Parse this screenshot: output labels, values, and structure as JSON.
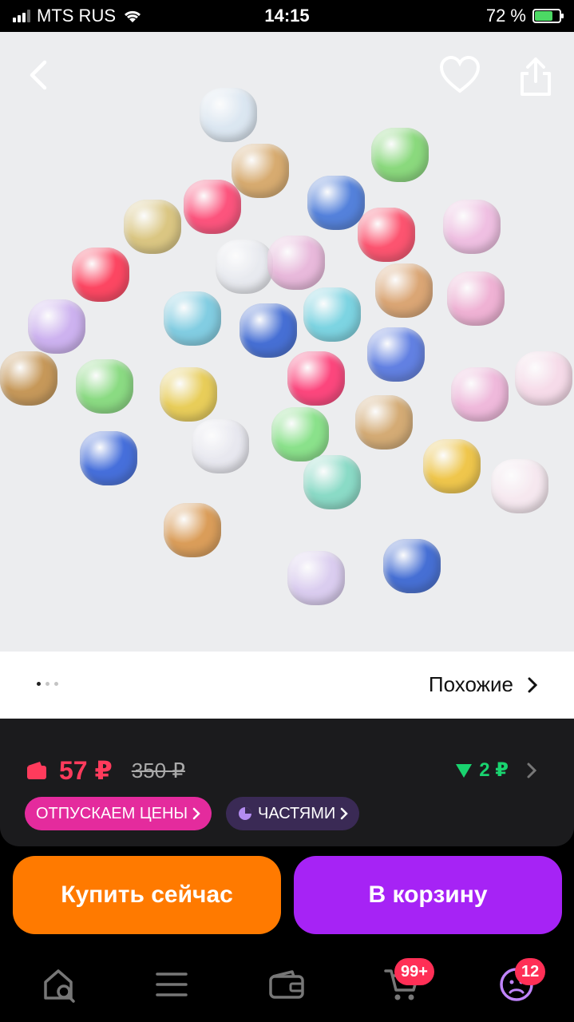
{
  "status_bar": {
    "carrier": "MTS RUS",
    "time": "14:15",
    "battery_percent": "72 %",
    "battery_level": 0.72
  },
  "product": {
    "image_alt_icon": "product-photo",
    "back_icon": "chevron-left-icon",
    "favorite_icon": "heart-icon",
    "share_icon": "share-icon",
    "gallery_total": 3,
    "gallery_active": 1
  },
  "similar": {
    "label": "Похожие"
  },
  "price": {
    "current": "57 ₽",
    "old": "350 ₽",
    "cashback": "2 ₽"
  },
  "chips": {
    "sale_label": "ОТПУСКАЕМ ЦЕНЫ",
    "parts_label": "ЧАСТЯМИ"
  },
  "actions": {
    "buy_label": "Купить сейчас",
    "cart_label": "В корзину"
  },
  "bottom_nav": {
    "cart_badge": "99+",
    "profile_badge": "12"
  },
  "colors": {
    "price_red": "#ff3b5c",
    "cashback_green": "#19d36f",
    "buy_orange": "#ff7a00",
    "cart_purple": "#a623f5",
    "chip_pink": "#e42b9d",
    "badge_red": "#ff2f56"
  }
}
